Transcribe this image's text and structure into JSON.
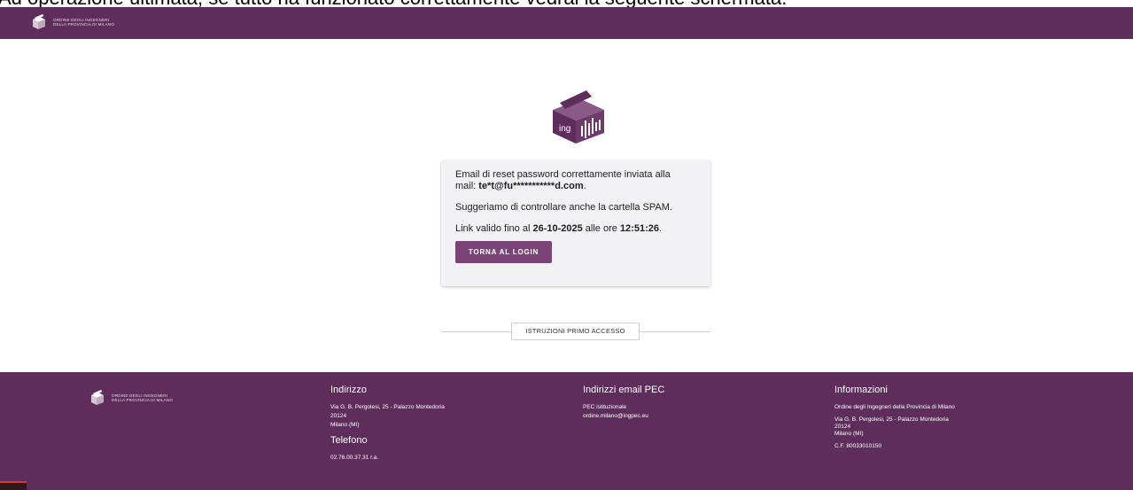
{
  "caption": "Ad operazione ultimata, se tutto ha funzionato correttamente vedrai la seguente schermata:",
  "brand": {
    "line1": "ORDINE DEGLI INGEGNERI",
    "line2": "DELLA PROVINCIA DI MILANO",
    "primary_color": "#5e2d5c",
    "button_color": "#7b4477"
  },
  "card": {
    "msg_line1": "Email di reset password correttamente inviata alla",
    "msg_mail_prefix": "mail: ",
    "email_masked": "te*t@fu***********d.com",
    "msg_period": ".",
    "spam_note": "Suggeriamo di controllare anche la cartella SPAM.",
    "valid_prefix": "Link valido fino al ",
    "valid_date": "26-10-2025",
    "valid_mid": " alle ore ",
    "valid_time": "12:51:26",
    "valid_period": ".",
    "back_button": "TORNA AL LOGIN"
  },
  "instructions_button": "ISTRUZIONI PRIMO ACCESSO",
  "footer": {
    "indirizzo": {
      "title": "Indirizzo",
      "street": "Via G. B. Pergolesi, 25 - Palazzo Montedoria",
      "cap": "20124",
      "city": "Milano (MI)"
    },
    "telefono": {
      "title": "Telefono",
      "number": "02.76.00.37.31 r.a."
    },
    "pec": {
      "title": "Indirizzi email PEC",
      "label": "PEC istituzionale",
      "email": "ordine.milano@ingpec.eu"
    },
    "info": {
      "title": "Informazioni",
      "org": "Ordine degli Ingegneri della Provincia di Milano",
      "street": "Via G. B. Pergolesi, 25 - Palazzo Montedoria",
      "cap": "20124",
      "city": "Milano (MI)",
      "cf": "C.F. 80033010150"
    }
  }
}
